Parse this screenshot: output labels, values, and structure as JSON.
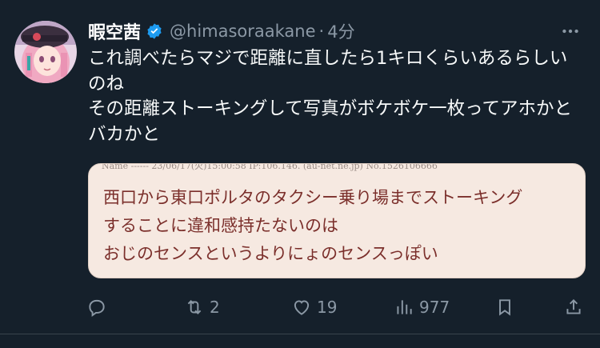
{
  "user": {
    "name": "暇空茜",
    "handle": "@himasoraakane",
    "separator": "·",
    "time": "4分"
  },
  "tweet": {
    "text": "これ調べたらマジで距離に直したら1キロくらいあるらしいのね\nその距離ストーキングして写真がボケボケ一枚ってアホかとバカかと"
  },
  "media": {
    "top_fragment": "Name  ------   23/06/17(火)15:00:58 IP:106.146.  (au-net.ne.jp)   No.1526106666",
    "lines": [
      "西口から東口ポルタのタクシー乗り場までストーキング",
      "することに違和感持たないのは",
      "おじのセンスというよりにょのセンスっぽい"
    ]
  },
  "actions": {
    "reply_count": "",
    "retweet_count": "2",
    "like_count": "19",
    "view_count": "977"
  },
  "icons": {
    "verified": "verified-badge-icon",
    "more": "more-icon",
    "reply": "reply-icon",
    "retweet": "retweet-icon",
    "like": "heart-icon",
    "views": "views-icon",
    "bookmark": "bookmark-icon",
    "share": "share-icon"
  },
  "colors": {
    "background": "#15202b",
    "text": "#f7f9f9",
    "secondary": "#8b98a5",
    "verified": "#1d9bf0",
    "media_bg": "#f6e9e1",
    "media_text": "#7b2f2b"
  }
}
